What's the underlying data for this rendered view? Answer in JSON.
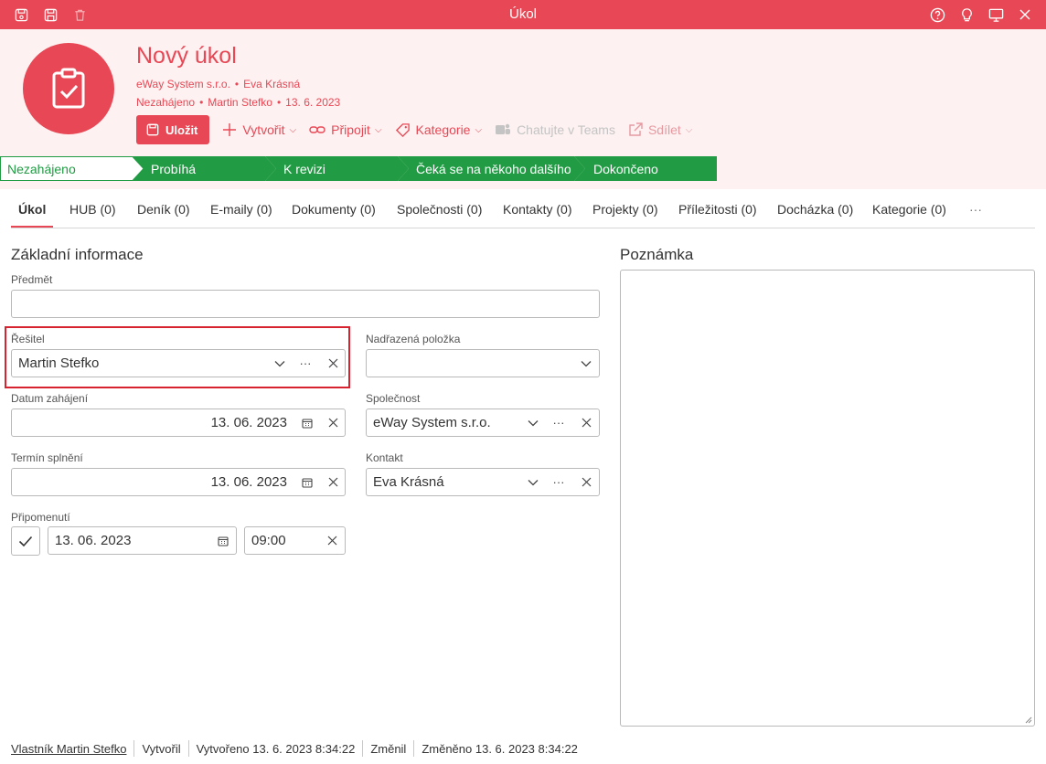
{
  "window": {
    "title": "Úkol",
    "left_icons": [
      "save-icon",
      "save-close-icon",
      "trash-icon"
    ],
    "right_icons": [
      "help-icon",
      "lightbulb-icon",
      "monitor-icon",
      "close-icon"
    ]
  },
  "header": {
    "title": "Nový úkol",
    "company": "eWay System s.r.o.",
    "contact": "Eva Krásná",
    "state": "Nezahájeno",
    "owner": "Martin Stefko",
    "date": "13. 6. 2023",
    "separator": "•",
    "icon": "clipboard-check-icon"
  },
  "actions": {
    "save": "Uložit",
    "create": "Vytvořit",
    "attach": "Připojit",
    "category": "Kategorie",
    "teams": "Chatujte v Teams",
    "share": "Sdílet"
  },
  "stages": [
    "Nezahájeno",
    "Probíhá",
    "K revizi",
    "Čeká se na někoho dalšího",
    "Dokončeno"
  ],
  "tabs": [
    "Úkol",
    "HUB (0)",
    "Deník (0)",
    "E-maily (0)",
    "Dokumenty (0)",
    "Společnosti (0)",
    "Kontakty (0)",
    "Projekty (0)",
    "Příležitosti (0)",
    "Docházka (0)",
    "Kategorie (0)",
    "···"
  ],
  "form": {
    "section_title": "Základní informace",
    "subject_label": "Předmět",
    "subject_value": "",
    "assignee_label": "Řešitel",
    "assignee_value": "Martin Stefko",
    "parent_label": "Nadřazená položka",
    "parent_value": "",
    "start_label": "Datum zahájení",
    "start_value": "13. 06. 2023",
    "company_label": "Společnost",
    "company_value": "eWay System s.r.o.",
    "due_label": "Termín splnění",
    "due_value": "13. 06. 2023",
    "contact_label": "Kontakt",
    "contact_value": "Eva Krásná",
    "reminder_label": "Připomenutí",
    "reminder_date": "13. 06. 2023",
    "reminder_time": "09:00",
    "more_glyph": "···"
  },
  "note": {
    "title": "Poznámka"
  },
  "footer": {
    "owner": "Vlastník Martin Stefko",
    "created_by": "Vytvořil",
    "created": "Vytvořeno 13. 6. 2023 8:34:22",
    "changed_by": "Změnil",
    "changed": "Změněno 13. 6. 2023 8:34:22"
  },
  "colors": {
    "accent": "#e84855",
    "header_bg": "#fdf1f1",
    "stage_green": "#219c44",
    "highlight": "#d6232f"
  }
}
